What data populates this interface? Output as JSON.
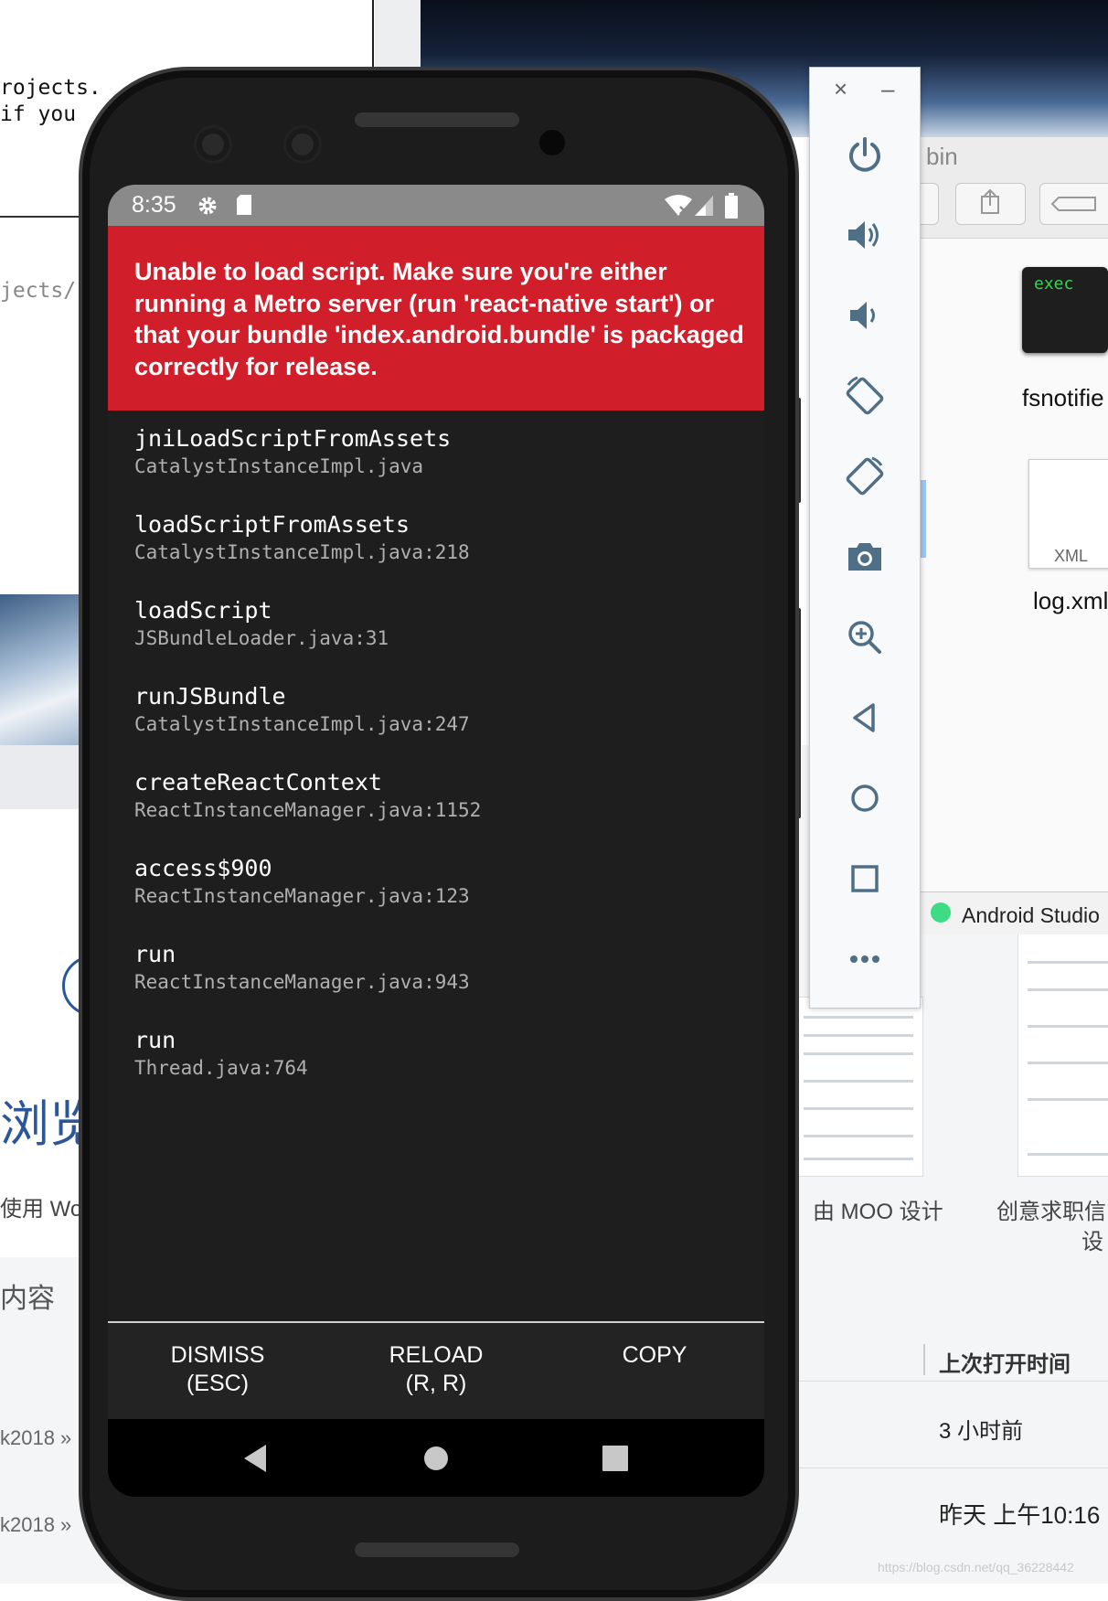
{
  "background": {
    "terminal_lines": [
      "rojects.",
      "if  you"
    ],
    "terminal_path": "jects/",
    "word_browse": "浏览",
    "word_use": "使用 Wo",
    "word_content": "内容",
    "recent_row1": "k2018 »",
    "recent_row2": "k2018 »",
    "template_caption1": "，由 MOO 设计",
    "template_caption2": "创意求职信",
    "template_caption2b": "设",
    "column_last_opened": "上次打开时间",
    "time_row1": "3 小时前",
    "time_row2": "昨天 上午10:16",
    "watermark": "https://blog.csdn.net/qq_36228442"
  },
  "finder": {
    "path_label": "bin",
    "exec_icon_label": "exec",
    "files": [
      "fsnotifie",
      "log.xml"
    ],
    "xml_icon_label": "XML",
    "app_name": "Android Studio"
  },
  "emulator_toolbar": {
    "close_label": "×",
    "minimize_label": "–",
    "buttons": [
      "power",
      "volume-up",
      "volume-down",
      "rotate-left",
      "rotate-right",
      "screenshot",
      "zoom",
      "back",
      "home",
      "overview",
      "more"
    ]
  },
  "phone": {
    "status_time": "8:35",
    "error_message": "Unable to load script. Make sure you're either running a Metro server (run 'react-native start') or that your bundle 'index.android.bundle' is packaged correctly for release.",
    "stack": [
      {
        "method": "jniLoadScriptFromAssets",
        "location": "CatalystInstanceImpl.java"
      },
      {
        "method": "loadScriptFromAssets",
        "location": "CatalystInstanceImpl.java:218"
      },
      {
        "method": "loadScript",
        "location": "JSBundleLoader.java:31"
      },
      {
        "method": "runJSBundle",
        "location": "CatalystInstanceImpl.java:247"
      },
      {
        "method": "createReactContext",
        "location": "ReactInstanceManager.java:1152"
      },
      {
        "method": "access$900",
        "location": "ReactInstanceManager.java:123"
      },
      {
        "method": "run",
        "location": "ReactInstanceManager.java:943"
      },
      {
        "method": "run",
        "location": "Thread.java:764"
      }
    ],
    "buttons": {
      "dismiss_line1": "DISMISS",
      "dismiss_line2": "(ESC)",
      "reload_line1": "RELOAD",
      "reload_line2": "(R, R)",
      "copy": "COPY"
    }
  },
  "colors": {
    "error_red": "#d01f2b",
    "redbox_background": "#1e1e1e",
    "status_bar": "#8a8a8a",
    "toolbar_icon": "#4f6f86"
  }
}
